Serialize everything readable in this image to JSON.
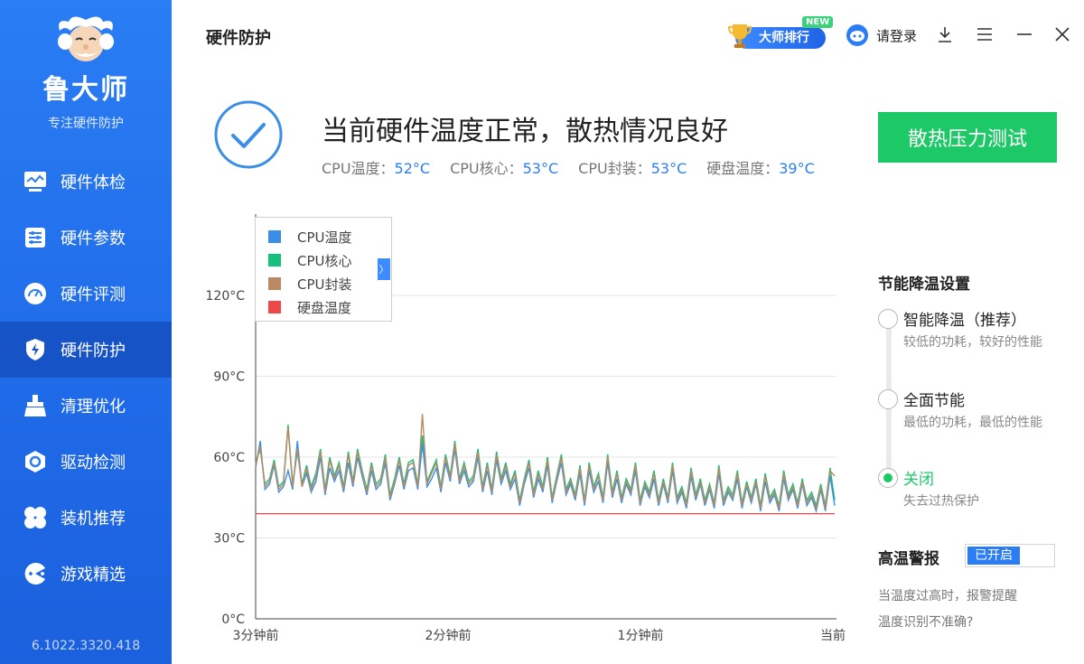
{
  "sidebar": {
    "brand": "鲁大师",
    "tagline": "专注硬件防护",
    "version": "6.1022.3320.418",
    "items": [
      {
        "label": "硬件体检",
        "icon": "monitor-icon"
      },
      {
        "label": "硬件参数",
        "icon": "sliders-icon"
      },
      {
        "label": "硬件评测",
        "icon": "gauge-icon"
      },
      {
        "label": "硬件防护",
        "icon": "shield-bolt-icon",
        "active": true
      },
      {
        "label": "清理优化",
        "icon": "broom-icon"
      },
      {
        "label": "驱动检测",
        "icon": "hexagon-icon"
      },
      {
        "label": "装机推荐",
        "icon": "clover-icon"
      },
      {
        "label": "游戏精选",
        "icon": "pacman-icon"
      }
    ]
  },
  "header": {
    "title": "硬件防护",
    "rank_label": "大师排行",
    "new_tag": "NEW",
    "login_label": "请登录"
  },
  "status": {
    "title": "当前硬件温度正常，散热情况良好",
    "metrics": [
      {
        "label": "CPU温度：",
        "value": "52°C"
      },
      {
        "label": "CPU核心：",
        "value": "53°C"
      },
      {
        "label": "CPU封装：",
        "value": "53°C"
      },
      {
        "label": "硬盘温度：",
        "value": "39°C"
      }
    ],
    "stress_button": "散热压力测试"
  },
  "colors": {
    "accent": "#2a7df4",
    "green": "#1dc866",
    "cpu_temp": "#3a8ee6",
    "cpu_core": "#14c07a",
    "cpu_package": "#b98a62",
    "disk_temp": "#f04848"
  },
  "chart_data": {
    "type": "line",
    "ylim": [
      0,
      120
    ],
    "y_ticks": [
      "0°C",
      "30°C",
      "60°C",
      "90°C",
      "120°C"
    ],
    "x_ticks": [
      "3分钟前",
      "2分钟前",
      "1分钟前",
      "当前"
    ],
    "legend_placement": "top-left",
    "grid": true,
    "series": [
      {
        "name": "CPU温度",
        "values": [
          56,
          66,
          48,
          50,
          57,
          47,
          49,
          55,
          48,
          66,
          49,
          54,
          47,
          51,
          60,
          46,
          56,
          51,
          55,
          47,
          58,
          49,
          60,
          53,
          46,
          55,
          48,
          50,
          58,
          44,
          50,
          57,
          48,
          55,
          56,
          48,
          65,
          49,
          52,
          56,
          47,
          58,
          51,
          63,
          50,
          55,
          49,
          51,
          60,
          47,
          55,
          46,
          59,
          50,
          55,
          48,
          52,
          42,
          50,
          56,
          45,
          52,
          47,
          57,
          43,
          51,
          58,
          46,
          50,
          44,
          54,
          42,
          55,
          47,
          51,
          43,
          58,
          45,
          52,
          43,
          50,
          46,
          55,
          42,
          49,
          45,
          52,
          42,
          50,
          43,
          55,
          43,
          47,
          41,
          53,
          44,
          50,
          42,
          48,
          41,
          54,
          42,
          47,
          44,
          52,
          41,
          49,
          43,
          50,
          40,
          51,
          43,
          46,
          40,
          52,
          44,
          48,
          41,
          50,
          42,
          45,
          40,
          48,
          40,
          53,
          42
        ]
      },
      {
        "name": "CPU核心",
        "values": [
          58,
          63,
          50,
          52,
          59,
          49,
          51,
          72,
          50,
          62,
          50,
          57,
          49,
          54,
          63,
          48,
          60,
          53,
          58,
          49,
          62,
          51,
          63,
          55,
          48,
          58,
          50,
          52,
          61,
          46,
          52,
          60,
          50,
          58,
          59,
          50,
          68,
          51,
          55,
          59,
          49,
          61,
          53,
          66,
          52,
          58,
          51,
          53,
          63,
          49,
          58,
          48,
          62,
          52,
          58,
          50,
          55,
          44,
          52,
          59,
          47,
          55,
          49,
          60,
          45,
          53,
          61,
          48,
          52,
          46,
          57,
          44,
          58,
          49,
          54,
          45,
          61,
          47,
          55,
          45,
          52,
          48,
          58,
          44,
          51,
          47,
          55,
          44,
          52,
          45,
          58,
          45,
          49,
          43,
          56,
          46,
          52,
          44,
          50,
          43,
          57,
          44,
          49,
          46,
          55,
          43,
          51,
          45,
          52,
          42,
          54,
          45,
          48,
          42,
          55,
          46,
          50,
          43,
          52,
          44,
          47,
          42,
          50,
          42,
          56,
          44
        ]
      },
      {
        "name": "CPU封装",
        "values": [
          57,
          64,
          49,
          51,
          58,
          48,
          50,
          71,
          49,
          63,
          49,
          56,
          48,
          53,
          62,
          47,
          59,
          52,
          57,
          48,
          61,
          50,
          62,
          54,
          47,
          57,
          49,
          51,
          60,
          45,
          51,
          59,
          49,
          57,
          58,
          49,
          76,
          50,
          54,
          58,
          48,
          60,
          52,
          65,
          51,
          57,
          50,
          52,
          62,
          48,
          57,
          47,
          61,
          51,
          57,
          49,
          54,
          43,
          51,
          58,
          46,
          54,
          48,
          59,
          44,
          52,
          60,
          47,
          51,
          45,
          56,
          43,
          57,
          48,
          53,
          44,
          60,
          46,
          54,
          44,
          51,
          47,
          57,
          43,
          50,
          46,
          54,
          43,
          51,
          44,
          57,
          44,
          48,
          42,
          55,
          45,
          51,
          43,
          49,
          42,
          56,
          43,
          48,
          45,
          54,
          42,
          50,
          44,
          51,
          41,
          53,
          44,
          47,
          41,
          54,
          45,
          49,
          42,
          51,
          43,
          46,
          41,
          49,
          41,
          55,
          53
        ]
      },
      {
        "name": "硬盘温度",
        "values": [
          39,
          39,
          39,
          39,
          39,
          39,
          39,
          39,
          39,
          39,
          39,
          39,
          39,
          39,
          39,
          39,
          39,
          39,
          39,
          39,
          39,
          39,
          39,
          39,
          39,
          39,
          39,
          39,
          39,
          39,
          39,
          39,
          39,
          39,
          39,
          39,
          39,
          39,
          39,
          39,
          39,
          39,
          39,
          39,
          39,
          39,
          39,
          39,
          39,
          39,
          39,
          39,
          39,
          39,
          39,
          39,
          39,
          39,
          39,
          39,
          39,
          39,
          39,
          39,
          39,
          39,
          39,
          39,
          39,
          39,
          39,
          39,
          39,
          39,
          39,
          39,
          39,
          39,
          39,
          39,
          39,
          39,
          39,
          39,
          39,
          39,
          39,
          39,
          39,
          39,
          39,
          39,
          39,
          39,
          39,
          39,
          39,
          39,
          39,
          39,
          39,
          39,
          39,
          39,
          39,
          39,
          39,
          39,
          39,
          39,
          39,
          39,
          39,
          39,
          39,
          39,
          39,
          39,
          39,
          39,
          39,
          39,
          39,
          39,
          39,
          39
        ]
      }
    ]
  },
  "settings": {
    "title": "节能降温设置",
    "options": [
      {
        "label": "智能降温（推荐）",
        "desc": "较低的功耗，较好的性能",
        "selected": false
      },
      {
        "label": "全面节能",
        "desc": "最低的功耗，最低的性能",
        "selected": false
      },
      {
        "label": "关闭",
        "desc": "失去过热保护",
        "selected": true
      }
    ]
  },
  "alarm": {
    "title": "高温警报",
    "toggle_label": "已开启",
    "desc": "当温度过高时，报警提醒",
    "link": "温度识别不准确?"
  }
}
